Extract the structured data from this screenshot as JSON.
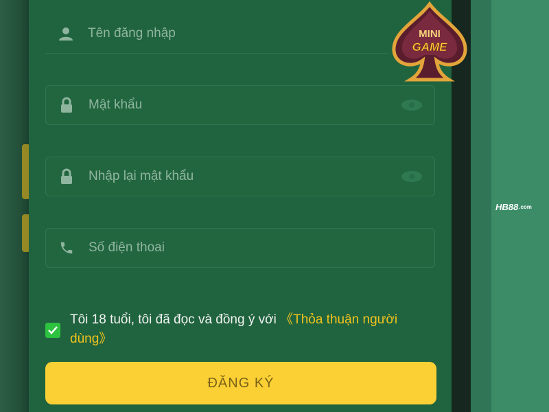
{
  "form": {
    "username_placeholder": "Tên đăng nhập",
    "password_placeholder": "Mật khẩu",
    "confirm_password_placeholder": "Nhập lại mật khẩu",
    "phone_placeholder": "Số điện thoai"
  },
  "agreement": {
    "checked": true,
    "text": "Tôi 18 tuổi, tôi đã đọc và đồng ý với",
    "link": "《Thỏa thuận người dùng》"
  },
  "submit_label": "ĐĂNG KÝ",
  "badge": {
    "line1": "MINI",
    "line2": "GAME"
  },
  "brand": {
    "name": "HB88",
    "suffix": ".com"
  },
  "colors": {
    "panel": "#20643f",
    "button": "#fbd034",
    "link": "#f2c21d",
    "checkbox": "#2dc23f"
  }
}
